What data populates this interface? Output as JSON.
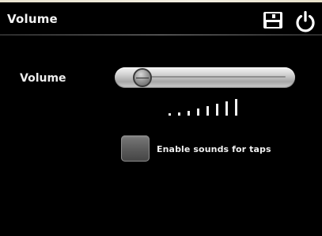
{
  "header": {
    "title": "Volume",
    "save_icon": "floppy-disk-icon",
    "power_icon": "power-icon"
  },
  "volume": {
    "label": "Volume",
    "level_fraction": 0.04,
    "indicator_bars": 8
  },
  "sounds": {
    "label": "Enable sounds for taps",
    "checked": false
  },
  "colors": {
    "background": "#000000",
    "text": "#f0f0f0",
    "slider_light": "#f4f4f4",
    "slider_dark": "#a7a7a7",
    "checkbox": "#5c5c5c"
  }
}
